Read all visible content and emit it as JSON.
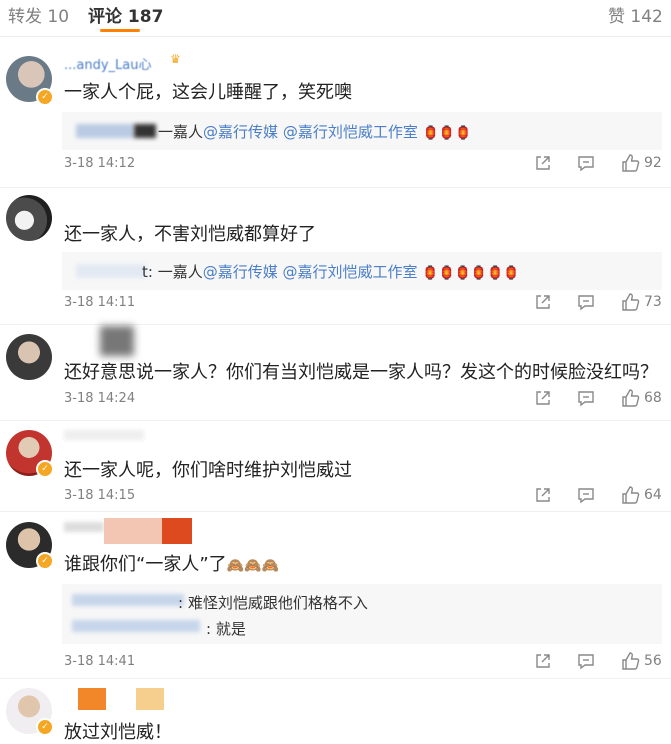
{
  "tabs": {
    "repost": "转发 10",
    "comments": "评论 187",
    "likes": "赞 142"
  },
  "comments": [
    {
      "username": "...andy_Lau心",
      "text": "一家人个屁，这会儿睡醒了，笑死噢",
      "replies": [
        {
          "prefix": "一嘉人",
          "mentions": [
            "@嘉行传媒",
            "@嘉行刘恺威工作室"
          ],
          "emoji": "🏮🏮🏮"
        }
      ],
      "time": "3-18 14:12",
      "likes": "92"
    },
    {
      "username": "",
      "text": "还一家人，不害刘恺威都算好了",
      "replies": [
        {
          "prefix": "t: 一嘉人",
          "mentions": [
            "@嘉行传媒",
            "@嘉行刘恺威工作室"
          ],
          "emoji": "🏮🏮🏮🏮🏮🏮"
        }
      ],
      "time": "3-18 14:11",
      "likes": "73"
    },
    {
      "username": "",
      "text": "还好意思说一家人？你们有当刘恺威是一家人吗？发这个的时候脸没红吗？",
      "replies": [],
      "time": "3-18 14:24",
      "likes": "68"
    },
    {
      "username": "",
      "text": "还一家人呢，你们啥时维护刘恺威过",
      "replies": [],
      "time": "3-18 14:15",
      "likes": "64"
    },
    {
      "username": "",
      "text": "谁跟你们“一家人”了",
      "emoji": "🙈🙈🙈",
      "replies": [
        {
          "prefix": "",
          "text": "难怪刘恺威跟他们格格不入"
        },
        {
          "prefix": "",
          "text": "就是"
        }
      ],
      "time": "3-18 14:41",
      "likes": "56"
    },
    {
      "username": "",
      "text": "放过刘恺威！",
      "replies": [],
      "time": "",
      "likes": ""
    }
  ],
  "icons": {
    "share": "share-icon",
    "comment": "comment-icon",
    "like": "thumbs-up-icon",
    "verified": "verified-badge-icon"
  },
  "colors": {
    "accent": "#ff8200",
    "link": "#4a7ec8",
    "muted": "#808080",
    "badge": "#f5a623"
  }
}
